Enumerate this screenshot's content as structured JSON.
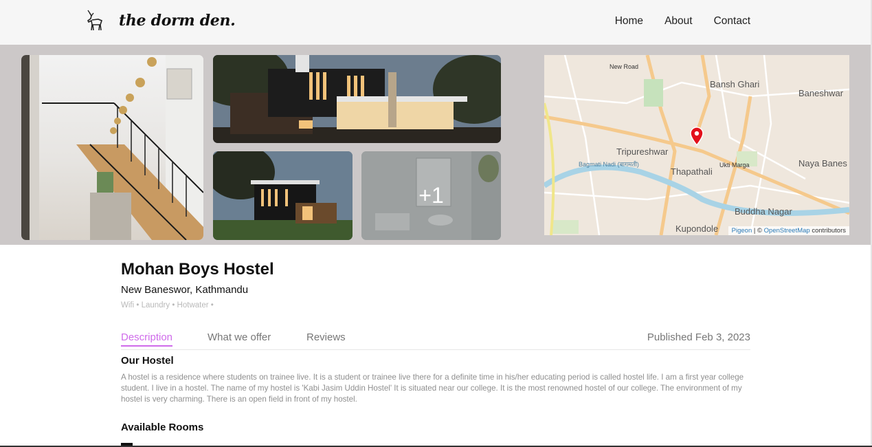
{
  "header": {
    "logo_text": "the dorm den.",
    "nav": [
      "Home",
      "About",
      "Contact"
    ]
  },
  "gallery": {
    "more_count": "+1",
    "map": {
      "labels": {
        "new_road": "New Road",
        "bansh_ghari": "Bansh Ghari",
        "baneshwar": "Baneshwar",
        "tripureshwar": "Tripureshwar",
        "thapathali": "Thapathali",
        "naya_banes": "Naya Banes",
        "bagmati": "Bagmati Nadi (बागमती)",
        "buddha_nagar": "Buddha Nagar",
        "kupondole": "Kupondole",
        "ukti_marga": "Ukti Marga"
      },
      "attribution": {
        "pigeon": "Pigeon",
        "sep": " | © ",
        "osm": "OpenStreetMap",
        "suffix": " contributors"
      }
    }
  },
  "hostel": {
    "name": "Mohan Boys Hostel",
    "location": "New Baneswor, Kathmandu",
    "amenities": "Wifi • Laundry • Hotwater •"
  },
  "tabs": {
    "items": [
      "Description",
      "What we offer",
      "Reviews"
    ],
    "active": "Description",
    "published": "Published Feb 3, 2023"
  },
  "description": {
    "heading": "Our Hostel",
    "text": "A hostel is a residence where students on trainee live. It is a student or trainee live there for a definite time in his/her educating period is called hostel life. I am a first year college student. I live in a hostel. The name of my hostel is 'Kabi Jasim Uddin Hostel' It is situated near our college. It is the most renowned hostel of our college. The environment of my hostel is very charming. There is an open field in front of my hostel."
  },
  "rooms": {
    "heading": "Available Rooms"
  },
  "colors": {
    "accent": "#cf6bea",
    "gallery_bg": "#ccc8c8",
    "pin": "#e3101b"
  }
}
